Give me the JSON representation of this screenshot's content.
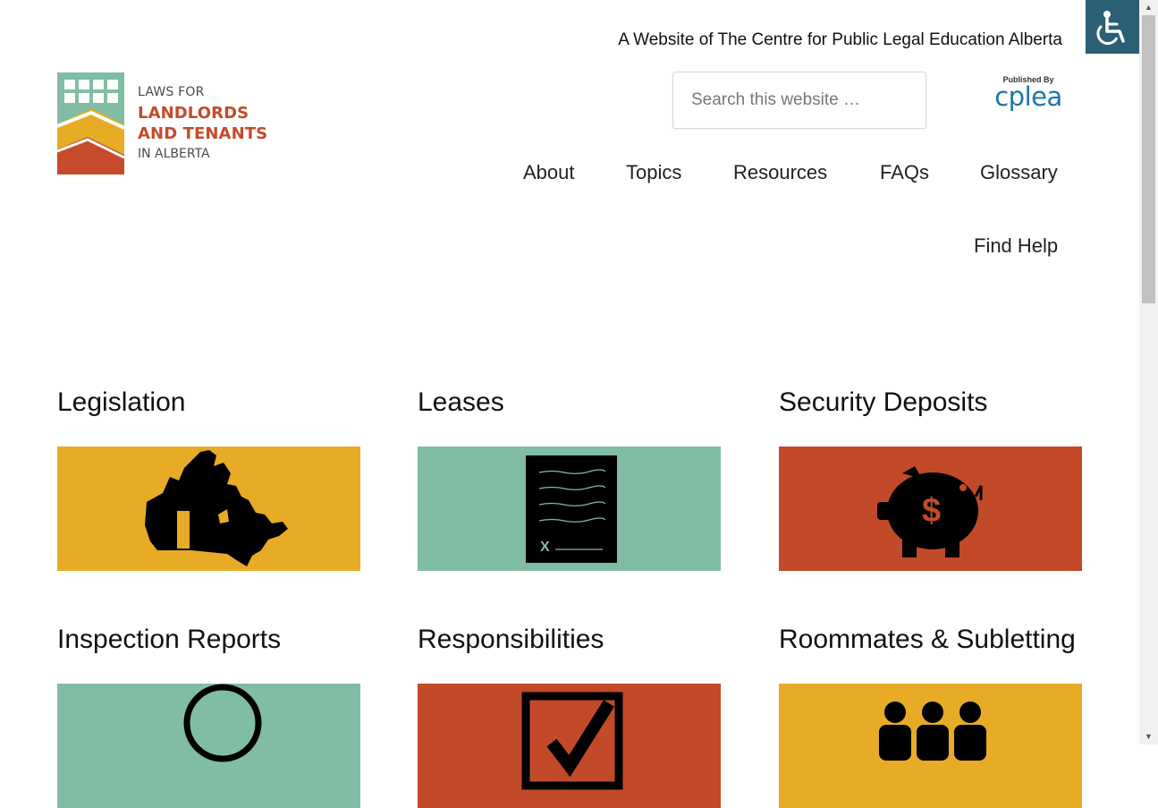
{
  "header": {
    "tagline": "A Website of The Centre for Public Legal Education Alberta",
    "search_placeholder": "Search this website …",
    "publisher_label": "Published By",
    "publisher_brand": "cplea"
  },
  "logo": {
    "line1": "LAWS FOR",
    "line2": "LANDLORDS",
    "line3": "AND TENANTS",
    "line4": "IN ALBERTA"
  },
  "nav": {
    "about": "About",
    "topics": "Topics",
    "resources": "Resources",
    "faqs": "FAQs",
    "glossary": "Glossary",
    "find_help": "Find Help"
  },
  "cards": [
    {
      "title": "Legislation",
      "color": "#e8ab26",
      "icon": "canada-map-icon"
    },
    {
      "title": "Leases",
      "color": "#80bda4",
      "icon": "lease-document-icon"
    },
    {
      "title": "Security Deposits",
      "color": "#c24a28",
      "icon": "piggy-bank-icon"
    },
    {
      "title": "Inspection Reports",
      "color": "#80bda4",
      "icon": "magnifying-glass-icon"
    },
    {
      "title": "Responsibilities",
      "color": "#c24a28",
      "icon": "checkbox-icon"
    },
    {
      "title": "Roommates & Subletting",
      "color": "#e8ab26",
      "icon": "people-icon"
    }
  ],
  "colors": {
    "accessibility_button": "#2b5f73",
    "brand_orange": "#c54b2a",
    "brand_yellow": "#e8ab26",
    "brand_green": "#80bda4",
    "cplea_blue": "#1d75ad"
  }
}
